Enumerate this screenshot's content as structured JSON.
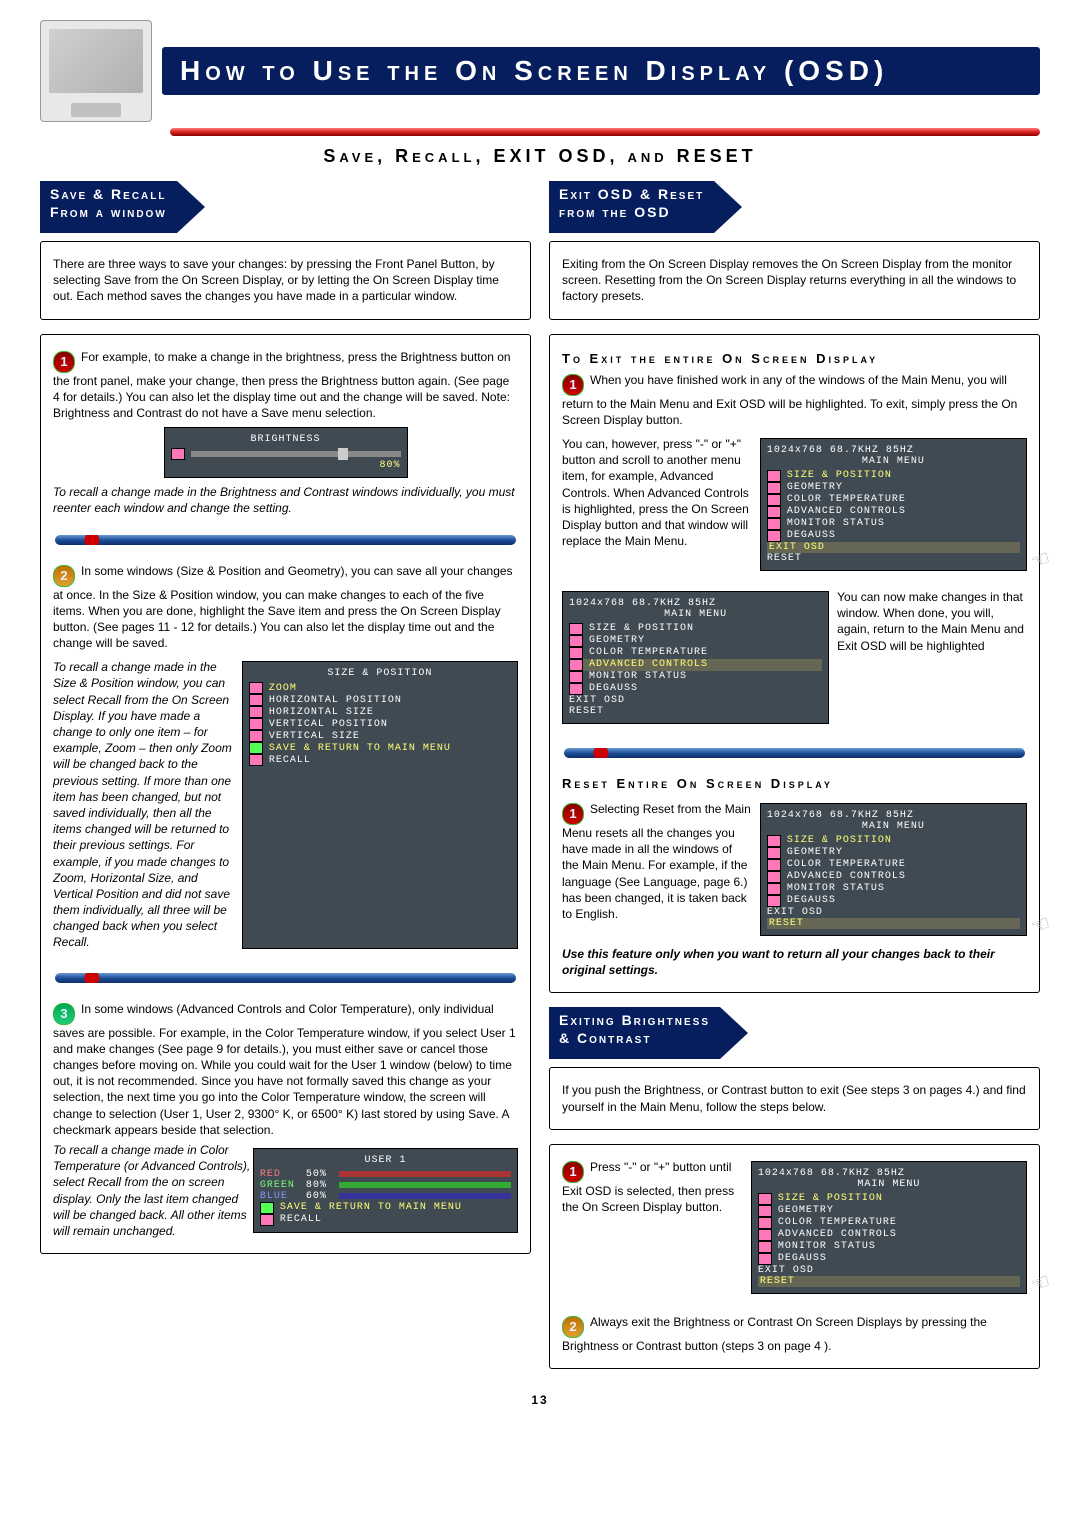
{
  "header": {
    "title": "How to Use the On Screen Display (OSD)",
    "subtitle": "Save, Recall, EXIT OSD, and RESET"
  },
  "left": {
    "flag": "Save & Recall\nFrom a window",
    "intro": "There are three ways to save your changes: by pressing the Front Panel Button, by selecting Save from the On Screen Display, or by letting the On Screen Display time out. Each method saves the changes you have made in a particular window.",
    "s1": {
      "text": "For example, to make a change in the brightness, press the Brightness button on the front panel, make your change, then press the Brightness button again. (See page 4 for details.) You can also let the display time out and the change will be saved. Note: Brightness and Contrast do not have a Save menu selection.",
      "osd": {
        "title": "BRIGHTNESS",
        "val": "80%"
      },
      "note": "To recall a change made in the Brightness and Contrast windows individually, you must reenter each window and change the setting."
    },
    "s2": {
      "text": "In some windows (Size & Position and Geometry), you can save all your changes at once. In the Size & Position window, you can make changes to each of the five items. When you are done, highlight the Save item and press the On Screen Display button. (See pages 11 - 12 for details.) You can also let the display time out and the change will be saved.",
      "osd": {
        "title": "SIZE & POSITION",
        "items": [
          "ZOOM",
          "HORIZONTAL POSITION",
          "HORIZONTAL SIZE",
          "VERTICAL POSITION",
          "VERTICAL SIZE"
        ],
        "foot": "SAVE & RETURN TO MAIN MENU",
        "foot2": "RECALL"
      },
      "note": "To recall a change made in the Size & Position window, you can select Recall from the On Screen Display. If you have made a change to only one item – for example, Zoom – then only Zoom will be changed back to the previous setting. If more than one item has been changed, but not saved individually, then all the items changed will be returned to their previous settings. For example, if you made changes to Zoom, Horizontal Size, and Vertical Position and did not save them individually, all three will be changed back when you select Recall."
    },
    "s3": {
      "text": "In some windows (Advanced Controls and Color Temperature), only individual saves are possible. For example, in the Color Temperature window, if you select User 1 and make changes (See page 9 for details.), you must either save or cancel those changes before moving on. While you could wait for the User 1 window (below) to time out, it is not recommended. Since you have not formally saved this change as your selection, the next time you go into the Color Temperature window, the screen will change to selection (User 1, User 2, 9300° K, or 6500° K) last stored by using Save. A checkmark appears beside that selection.",
      "osd": {
        "title": "USER 1",
        "rows": [
          {
            "k": "RED",
            "v": "50%"
          },
          {
            "k": "GREEN",
            "v": "80%"
          },
          {
            "k": "BLUE",
            "v": "60%"
          }
        ],
        "foot": "SAVE & RETURN TO MAIN MENU",
        "foot2": "RECALL"
      },
      "note": "To recall a change made in Color Temperature (or Advanced Controls), select Recall from the on screen display. Only the last item changed will be changed back. All other items will remain unchanged."
    }
  },
  "right": {
    "flag": "Exit OSD & Reset\nfrom the OSD",
    "intro": "Exiting from the On Screen Display removes the On Screen Display from the monitor screen. Resetting from the On Screen Display returns everything in all the windows to factory presets.",
    "exitHead": "To Exit the entire On Screen Display",
    "e1a": "When you have finished work in any of the windows of the Main Menu, you will return to the Main Menu and Exit OSD will be highlighted. To exit, simply press the On Screen Display button.",
    "e1b": "You can, however, press \"-\" or \"+\" button and scroll to another menu item, for example, Advanced Controls. When Advanced Controls is highlighted, press the On Screen Display button and that window will replace the Main Menu.",
    "e1c": "You can now make changes in that window. When done, you will, again, return to the Main Menu and Exit OSD will be highlighted",
    "menuRes": "1024x768  68.7KHZ  85HZ",
    "menuTitle": "MAIN MENU",
    "menuItems": [
      "SIZE & POSITION",
      "GEOMETRY",
      "COLOR TEMPERATURE",
      "ADVANCED CONTROLS",
      "MONITOR STATUS",
      "DEGAUSS"
    ],
    "menuExit": "EXIT OSD",
    "menuReset": "RESET",
    "resetHead": "Reset Entire On Screen Display",
    "r1": "Selecting Reset from the Main Menu resets all the changes you have made in all the windows of the Main Menu. For example, if the language (See Language, page 6.) has been changed, it is taken back to English.",
    "r1b": "Use this feature only when you want to return all your changes back to their original settings.",
    "flag2": "Exiting Brightness\n& Contrast",
    "b0": "If you push the Brightness, or Contrast button to exit (See steps 3 on pages 4.) and find yourself in the Main Menu, follow the steps below.",
    "b1": "Press \"-\" or \"+\" button until Exit OSD is selected, then press the On Screen Display button.",
    "b2": "Always exit the Brightness or Contrast On Screen Displays by pressing the Brightness or Contrast button (steps 3 on page 4 )."
  },
  "pgnum": "13"
}
